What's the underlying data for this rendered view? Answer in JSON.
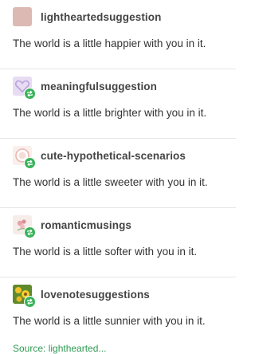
{
  "posts": [
    {
      "username": "lightheartedsuggestion",
      "text": "The world is a little happier with you in it.",
      "reblogged": false,
      "avatar_color": "#dcb9b2"
    },
    {
      "username": "meaningfulsuggestion",
      "text": "The world is a little brighter with you in it.",
      "reblogged": true,
      "avatar_color": "#c9b6e6"
    },
    {
      "username": "cute-hypothetical-scenarios",
      "text": "The world is a little sweeter with you in it.",
      "reblogged": true,
      "avatar_color": "#f3d9d4"
    },
    {
      "username": "romanticmusings",
      "text": "The world is a little softer with you in it.",
      "reblogged": true,
      "avatar_color": "#f2e4e1"
    },
    {
      "username": "lovenotesuggestions",
      "text": "The world is a little sunnier with you in it.",
      "reblogged": true,
      "avatar_color": "#7a9a2e"
    }
  ],
  "footer_text": "Source: lighthearted...",
  "colors": {
    "reblog_badge": "#39b35b",
    "text": "#333333",
    "divider": "#e6e6e6"
  },
  "icons": {
    "reblog_badge": "reblog-icon"
  }
}
